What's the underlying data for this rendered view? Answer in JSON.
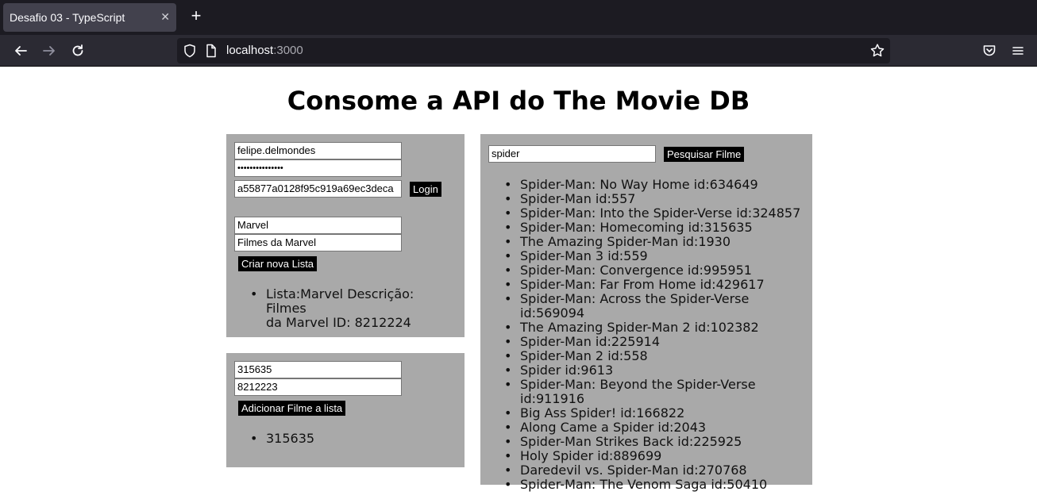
{
  "browser": {
    "tab_title": "Desafio 03 - TypeScript",
    "url_host": "localhost",
    "url_port": ":3000"
  },
  "page": {
    "title": "Consome a API do The Movie DB"
  },
  "login": {
    "username": "felipe.delmondes",
    "password": "•••••••••••••••",
    "api_key": "a55877a0128f95c919a69ec3deca",
    "login_label": "Login"
  },
  "create_list": {
    "name": "Marvel",
    "description": "Filmes da Marvel",
    "button_label": "Criar nova Lista",
    "result_line1": "Lista:Marvel Descrição: Filmes",
    "result_line2": "da Marvel ID: 8212224"
  },
  "add_movie": {
    "movie_id": "315635",
    "list_id": "8212223",
    "button_label": "Adicionar Filme a lista",
    "result": "315635"
  },
  "search": {
    "query": "spider",
    "button_label": "Pesquisar Filme",
    "results": [
      "Spider-Man: No Way Home id:634649",
      "Spider-Man id:557",
      "Spider-Man: Into the Spider-Verse id:324857",
      "Spider-Man: Homecoming id:315635",
      "The Amazing Spider-Man id:1930",
      "Spider-Man 3 id:559",
      "Spider-Man: Convergence id:995951",
      "Spider-Man: Far From Home id:429617",
      "Spider-Man: Across the Spider-Verse id:569094",
      "The Amazing Spider-Man 2 id:102382",
      "Spider-Man id:225914",
      "Spider-Man 2 id:558",
      "Spider id:9613",
      "Spider-Man: Beyond the Spider-Verse id:911916",
      "Big Ass Spider! id:166822",
      "Along Came a Spider id:2043",
      "Spider-Man Strikes Back id:225925",
      "Holy Spider id:889699",
      "Daredevil vs. Spider-Man id:270768",
      "Spider-Man: The Venom Saga id:50410"
    ]
  }
}
